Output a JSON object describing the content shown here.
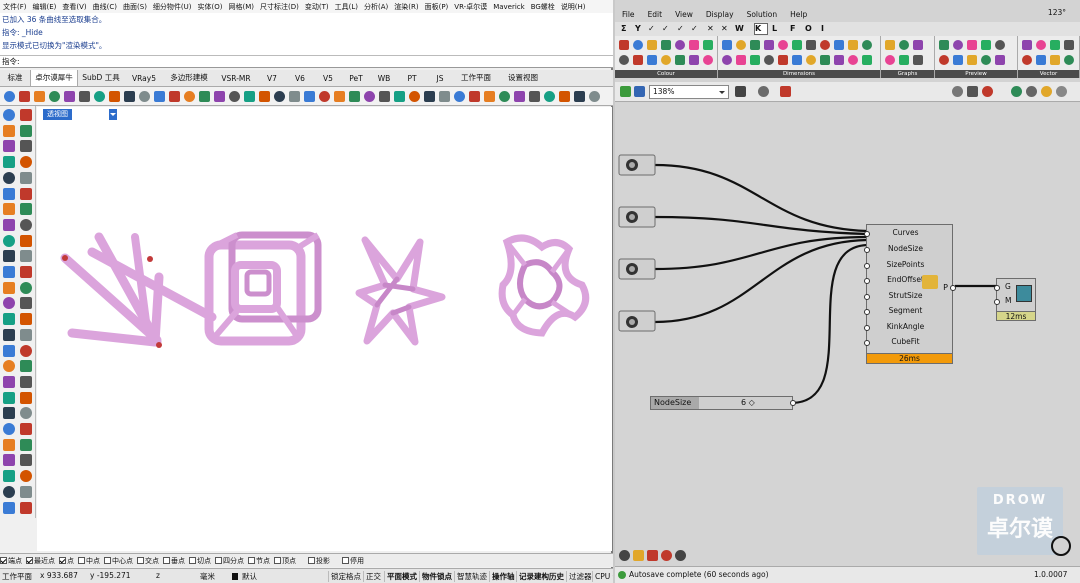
{
  "rhino": {
    "menus": [
      "文件(F)",
      "编辑(E)",
      "查看(V)",
      "曲线(C)",
      "曲面(S)",
      "细分物件(U)",
      "实体(O)",
      "网格(M)",
      "尺寸标注(D)",
      "变动(T)",
      "工具(L)",
      "分析(A)",
      "渲染(R)",
      "面板(P)",
      "VR-卓尔谟",
      "Maverick",
      "BG螺栓",
      "说明(H)"
    ],
    "history": [
      "已加入 36 条曲线至选取集合。",
      "指令: _Hide",
      "显示模式已切换为\"渲染模式\"。"
    ],
    "command_prompt": "指令:",
    "tabs": [
      "标准",
      "卓尔谟犀牛",
      "SubD 工具",
      "VRay5",
      "多边形建模",
      "VSR-MR",
      "V7",
      "V6",
      "V5",
      "PeT",
      "WB",
      "PT",
      "JS",
      "工作平面",
      "设置视图"
    ],
    "active_tab": "卓尔谟犀牛",
    "viewport_label": "透视图",
    "osnaps": [
      {
        "label": "端点",
        "on": true
      },
      {
        "label": "最近点",
        "on": true
      },
      {
        "label": "点",
        "on": true
      },
      {
        "label": "中点",
        "on": false
      },
      {
        "label": "中心点",
        "on": false
      },
      {
        "label": "交点",
        "on": false
      },
      {
        "label": "垂点",
        "on": false
      },
      {
        "label": "切点",
        "on": false
      },
      {
        "label": "四分点",
        "on": false
      },
      {
        "label": "节点",
        "on": false
      },
      {
        "label": "顶点",
        "on": false
      },
      {
        "label": "投影",
        "on": false
      },
      {
        "label": "停用",
        "on": false
      }
    ],
    "status": {
      "cplane": "工作平面",
      "x": "x 933.687",
      "y": "y -195.271",
      "z": "z",
      "units": "毫米",
      "layer": "默认",
      "lock_grid": "锁定格点",
      "ortho": "正交",
      "planar": "平面模式",
      "osnap": "物件锁点",
      "smarttrack": "智慧轨迹",
      "gumball": "操作轴",
      "history": "记录建构历史",
      "filter": "过滤器",
      "cpu": "CPU 使"
    }
  },
  "gh": {
    "menus": [
      "File",
      "Edit",
      "View",
      "Display",
      "Solution",
      "Help"
    ],
    "menu_right": "123°",
    "tabs": [
      "Σ",
      "Y",
      "✓",
      "✓",
      "✓",
      "✓",
      "✕",
      "✕",
      "W",
      "K",
      "L",
      "F",
      "O",
      "I"
    ],
    "ribbon_groups": [
      "Colour",
      "Dimensions",
      "Graphs",
      "Preview",
      "Vector"
    ],
    "zoom": "138%",
    "component": {
      "inputs": [
        "Curves",
        "NodeSize",
        "SizePoints",
        "EndOffset",
        "StrutSize",
        "Segment",
        "KinkAngle",
        "CubeFit"
      ],
      "output": "P",
      "timer": "26ms"
    },
    "preview": {
      "inputs": [
        "G",
        "M"
      ],
      "timer": "12ms"
    },
    "slider": {
      "name": "NodeSize",
      "value": "6 ◇"
    },
    "status_left": "Autosave complete (60 seconds ago)",
    "status_right": "1.0.0007",
    "watermark": {
      "line1": "DROW",
      "line2": "卓尔谟"
    }
  }
}
